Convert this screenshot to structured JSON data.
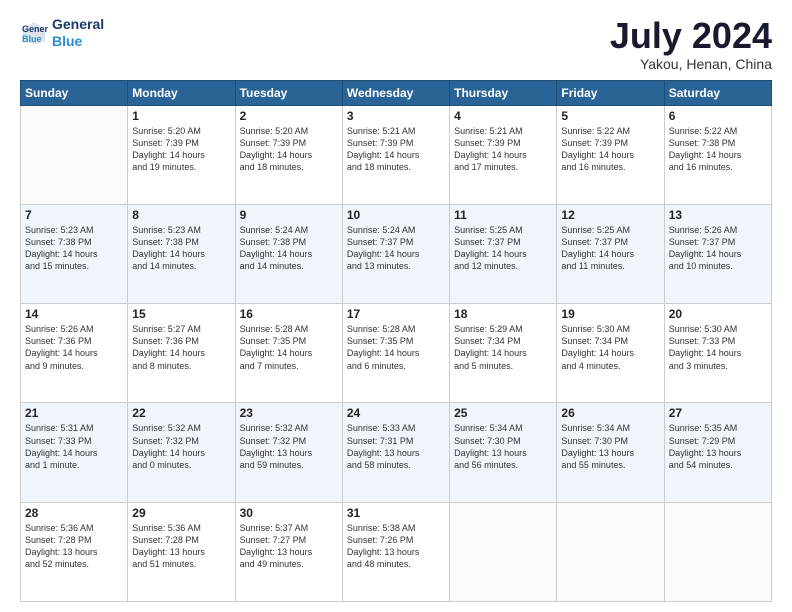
{
  "header": {
    "logo_line1": "General",
    "logo_line2": "Blue",
    "month": "July 2024",
    "location": "Yakou, Henan, China"
  },
  "days_of_week": [
    "Sunday",
    "Monday",
    "Tuesday",
    "Wednesday",
    "Thursday",
    "Friday",
    "Saturday"
  ],
  "weeks": [
    [
      {
        "day": "",
        "text": ""
      },
      {
        "day": "1",
        "text": "Sunrise: 5:20 AM\nSunset: 7:39 PM\nDaylight: 14 hours\nand 19 minutes."
      },
      {
        "day": "2",
        "text": "Sunrise: 5:20 AM\nSunset: 7:39 PM\nDaylight: 14 hours\nand 18 minutes."
      },
      {
        "day": "3",
        "text": "Sunrise: 5:21 AM\nSunset: 7:39 PM\nDaylight: 14 hours\nand 18 minutes."
      },
      {
        "day": "4",
        "text": "Sunrise: 5:21 AM\nSunset: 7:39 PM\nDaylight: 14 hours\nand 17 minutes."
      },
      {
        "day": "5",
        "text": "Sunrise: 5:22 AM\nSunset: 7:39 PM\nDaylight: 14 hours\nand 16 minutes."
      },
      {
        "day": "6",
        "text": "Sunrise: 5:22 AM\nSunset: 7:38 PM\nDaylight: 14 hours\nand 16 minutes."
      }
    ],
    [
      {
        "day": "7",
        "text": "Sunrise: 5:23 AM\nSunset: 7:38 PM\nDaylight: 14 hours\nand 15 minutes."
      },
      {
        "day": "8",
        "text": "Sunrise: 5:23 AM\nSunset: 7:38 PM\nDaylight: 14 hours\nand 14 minutes."
      },
      {
        "day": "9",
        "text": "Sunrise: 5:24 AM\nSunset: 7:38 PM\nDaylight: 14 hours\nand 14 minutes."
      },
      {
        "day": "10",
        "text": "Sunrise: 5:24 AM\nSunset: 7:37 PM\nDaylight: 14 hours\nand 13 minutes."
      },
      {
        "day": "11",
        "text": "Sunrise: 5:25 AM\nSunset: 7:37 PM\nDaylight: 14 hours\nand 12 minutes."
      },
      {
        "day": "12",
        "text": "Sunrise: 5:25 AM\nSunset: 7:37 PM\nDaylight: 14 hours\nand 11 minutes."
      },
      {
        "day": "13",
        "text": "Sunrise: 5:26 AM\nSunset: 7:37 PM\nDaylight: 14 hours\nand 10 minutes."
      }
    ],
    [
      {
        "day": "14",
        "text": "Sunrise: 5:26 AM\nSunset: 7:36 PM\nDaylight: 14 hours\nand 9 minutes."
      },
      {
        "day": "15",
        "text": "Sunrise: 5:27 AM\nSunset: 7:36 PM\nDaylight: 14 hours\nand 8 minutes."
      },
      {
        "day": "16",
        "text": "Sunrise: 5:28 AM\nSunset: 7:35 PM\nDaylight: 14 hours\nand 7 minutes."
      },
      {
        "day": "17",
        "text": "Sunrise: 5:28 AM\nSunset: 7:35 PM\nDaylight: 14 hours\nand 6 minutes."
      },
      {
        "day": "18",
        "text": "Sunrise: 5:29 AM\nSunset: 7:34 PM\nDaylight: 14 hours\nand 5 minutes."
      },
      {
        "day": "19",
        "text": "Sunrise: 5:30 AM\nSunset: 7:34 PM\nDaylight: 14 hours\nand 4 minutes."
      },
      {
        "day": "20",
        "text": "Sunrise: 5:30 AM\nSunset: 7:33 PM\nDaylight: 14 hours\nand 3 minutes."
      }
    ],
    [
      {
        "day": "21",
        "text": "Sunrise: 5:31 AM\nSunset: 7:33 PM\nDaylight: 14 hours\nand 1 minute."
      },
      {
        "day": "22",
        "text": "Sunrise: 5:32 AM\nSunset: 7:32 PM\nDaylight: 14 hours\nand 0 minutes."
      },
      {
        "day": "23",
        "text": "Sunrise: 5:32 AM\nSunset: 7:32 PM\nDaylight: 13 hours\nand 59 minutes."
      },
      {
        "day": "24",
        "text": "Sunrise: 5:33 AM\nSunset: 7:31 PM\nDaylight: 13 hours\nand 58 minutes."
      },
      {
        "day": "25",
        "text": "Sunrise: 5:34 AM\nSunset: 7:30 PM\nDaylight: 13 hours\nand 56 minutes."
      },
      {
        "day": "26",
        "text": "Sunrise: 5:34 AM\nSunset: 7:30 PM\nDaylight: 13 hours\nand 55 minutes."
      },
      {
        "day": "27",
        "text": "Sunrise: 5:35 AM\nSunset: 7:29 PM\nDaylight: 13 hours\nand 54 minutes."
      }
    ],
    [
      {
        "day": "28",
        "text": "Sunrise: 5:36 AM\nSunset: 7:28 PM\nDaylight: 13 hours\nand 52 minutes."
      },
      {
        "day": "29",
        "text": "Sunrise: 5:36 AM\nSunset: 7:28 PM\nDaylight: 13 hours\nand 51 minutes."
      },
      {
        "day": "30",
        "text": "Sunrise: 5:37 AM\nSunset: 7:27 PM\nDaylight: 13 hours\nand 49 minutes."
      },
      {
        "day": "31",
        "text": "Sunrise: 5:38 AM\nSunset: 7:26 PM\nDaylight: 13 hours\nand 48 minutes."
      },
      {
        "day": "",
        "text": ""
      },
      {
        "day": "",
        "text": ""
      },
      {
        "day": "",
        "text": ""
      }
    ]
  ]
}
